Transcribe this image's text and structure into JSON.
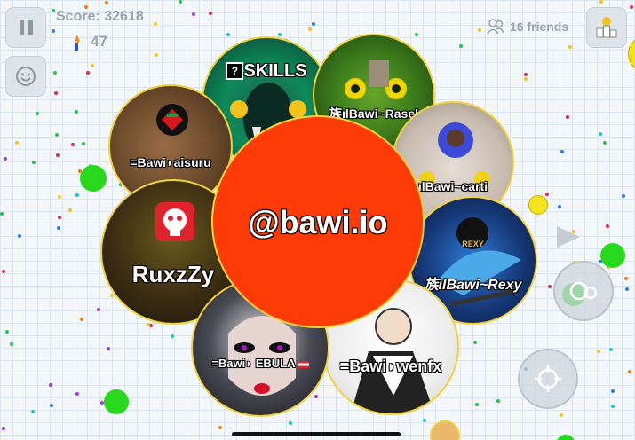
{
  "hud": {
    "score_label": "Score: 32618",
    "coins": "47",
    "friends": "16 friends"
  },
  "cells": {
    "center": "@bawi.io",
    "skills": "SKILLS",
    "rasel": "族ılBawi~Rasel",
    "carti": "ılBawi~carti",
    "rexy": "族ılBawi~Rexy",
    "rexy_logo": "REXY",
    "wenfx": "=Bawi◗wenfx",
    "ebula": "=Bawi◗ EBULA",
    "ruxzzy": "RuxzZy",
    "aisuru": "=Bawi◗aisuru"
  },
  "colors": {
    "center": "#fd3b06",
    "cell_border": "#f1d23a"
  }
}
